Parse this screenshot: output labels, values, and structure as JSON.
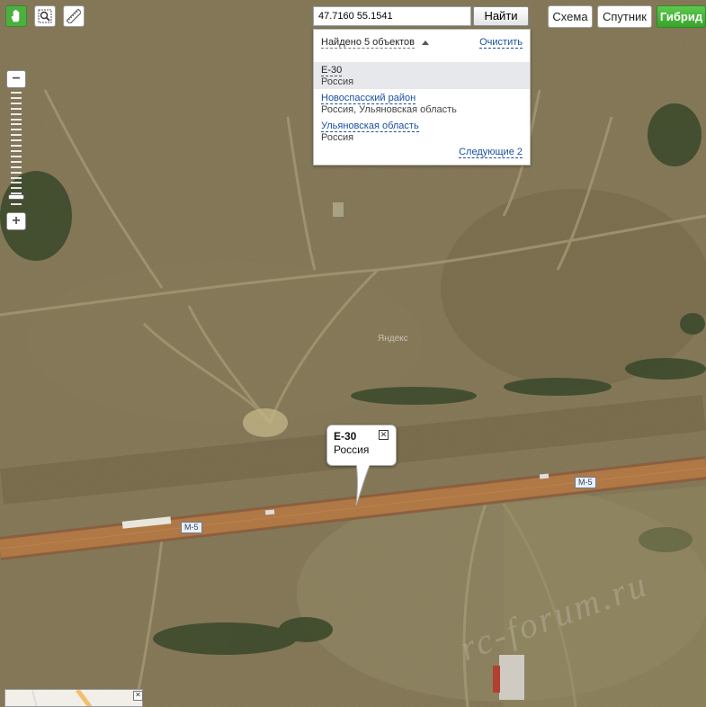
{
  "toolbar": {
    "tools": [
      {
        "name": "hand-icon",
        "active": true
      },
      {
        "name": "magnifier-zoom-icon",
        "active": false
      },
      {
        "name": "ruler-icon",
        "active": false
      }
    ]
  },
  "zoom": {
    "minus_label": "−",
    "plus_label": "+",
    "level_fraction": 0.08
  },
  "search": {
    "query": "47.7160 55.1541",
    "button_label": "Найти",
    "found_label": "Найдено 5 объектов",
    "clear_label": "Очистить",
    "next_label": "Следующие 2",
    "results": [
      {
        "title": "E-30",
        "subtitle": "Россия",
        "selected": true
      },
      {
        "title": "Новоспасский район",
        "subtitle": "Россия, Ульяновская область",
        "selected": false
      },
      {
        "title": "Ульяновская область",
        "subtitle": "Россия",
        "selected": false
      }
    ]
  },
  "layers": {
    "scheme_label": "Схема",
    "satellite_label": "Спутник",
    "hybrid_label": "Гибрид",
    "active": "hybrid"
  },
  "balloon": {
    "title": "E-30",
    "subtitle": "Россия",
    "close_icon": "close-icon"
  },
  "map": {
    "road_labels": [
      "M-5",
      "M-5"
    ],
    "watermark": "Яндекс",
    "forum_watermark": "rc-forum.ru"
  },
  "colors": {
    "accent_green": "#4caf3f",
    "link_blue": "#1a4fa0",
    "road": "#b07845"
  }
}
